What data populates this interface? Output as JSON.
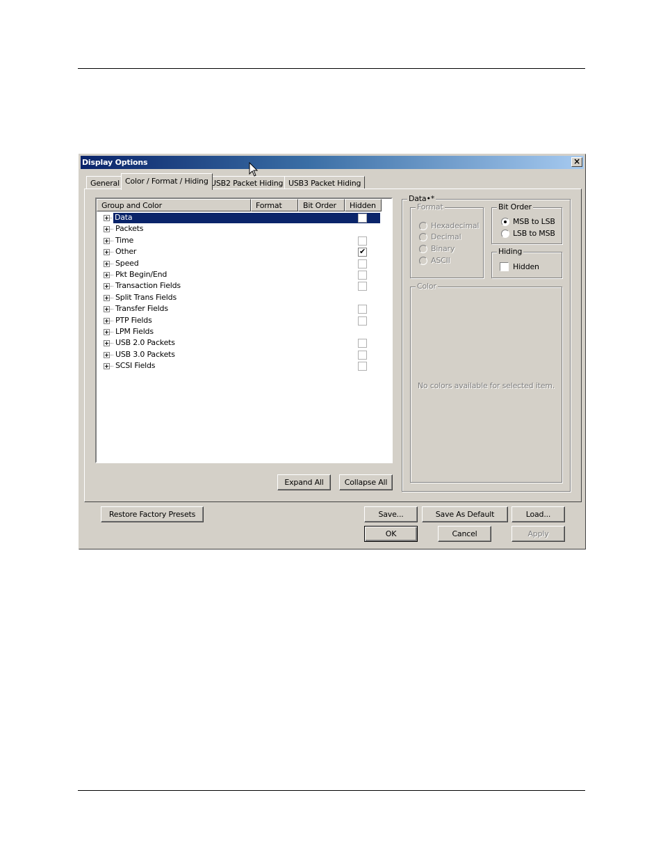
{
  "dialog": {
    "title": "Display Options",
    "close_symbol": "×"
  },
  "tabs": [
    {
      "label": "General",
      "active": false
    },
    {
      "label": "Color / Format / Hiding",
      "active": true
    },
    {
      "label": "USB2 Packet Hiding",
      "active": false
    },
    {
      "label": "USB3 Packet Hiding",
      "active": false
    }
  ],
  "list": {
    "columns": [
      "Group and Color",
      "Format",
      "Bit Order",
      "Hidden"
    ],
    "rows": [
      {
        "label": "Data",
        "hidden_checkbox": true,
        "checked": false,
        "selected": true
      },
      {
        "label": "Packets",
        "hidden_checkbox": false,
        "checked": false
      },
      {
        "label": "Time",
        "hidden_checkbox": true,
        "checked": false
      },
      {
        "label": "Other",
        "hidden_checkbox": true,
        "checked": true
      },
      {
        "label": "Speed",
        "hidden_checkbox": true,
        "checked": false
      },
      {
        "label": "Pkt Begin/End",
        "hidden_checkbox": true,
        "checked": false
      },
      {
        "label": "Transaction Fields",
        "hidden_checkbox": true,
        "checked": false
      },
      {
        "label": "Split Trans Fields",
        "hidden_checkbox": false,
        "checked": false
      },
      {
        "label": "Transfer Fields",
        "hidden_checkbox": true,
        "checked": false
      },
      {
        "label": "PTP Fields",
        "hidden_checkbox": true,
        "checked": false
      },
      {
        "label": "LPM Fields",
        "hidden_checkbox": false,
        "checked": false
      },
      {
        "label": "USB 2.0 Packets",
        "hidden_checkbox": true,
        "checked": false
      },
      {
        "label": "USB 3.0 Packets",
        "hidden_checkbox": true,
        "checked": false
      },
      {
        "label": "SCSI Fields",
        "hidden_checkbox": true,
        "checked": false
      }
    ],
    "checkmark": "✔",
    "expand_all_label": "Expand All",
    "collapse_all_label": "Collapse All"
  },
  "data_panel": {
    "title": "Data•*",
    "format": {
      "title": "Format",
      "options": [
        "Hexadecimal",
        "Decimal",
        "Binary",
        "ASCII"
      ]
    },
    "bit_order": {
      "title": "Bit Order",
      "options": [
        "MSB to LSB",
        "LSB to MSB"
      ],
      "selected": "MSB to LSB"
    },
    "hiding": {
      "title": "Hiding",
      "checkbox_label": "Hidden",
      "checked": false
    },
    "color": {
      "title": "Color",
      "message": "No colors available for selected item."
    }
  },
  "footer": {
    "restore_label": "Restore Factory Presets",
    "save_label": "Save...",
    "save_default_label": "Save As Default",
    "load_label": "Load...",
    "ok_label": "OK",
    "cancel_label": "Cancel",
    "apply_label": "Apply"
  }
}
